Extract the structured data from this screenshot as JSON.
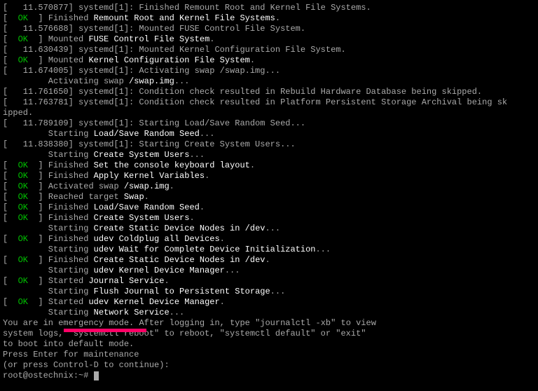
{
  "lines": [
    {
      "kind": "ts",
      "time": "11.570877",
      "src": "systemd[1]",
      "msg": "Finished Remount Root and Kernel File Systems."
    },
    {
      "kind": "ok",
      "pre": "Finished ",
      "bold": "Remount Root and Kernel File Systems",
      "post": "."
    },
    {
      "kind": "ts",
      "time": "11.576688",
      "src": "systemd[1]",
      "msg": "Mounted FUSE Control File System."
    },
    {
      "kind": "ok",
      "pre": "Mounted ",
      "bold": "FUSE Control File System",
      "post": "."
    },
    {
      "kind": "ts",
      "time": "11.630439",
      "src": "systemd[1]",
      "msg": "Mounted Kernel Configuration File System."
    },
    {
      "kind": "ok",
      "pre": "Mounted ",
      "bold": "Kernel Configuration File System",
      "post": "."
    },
    {
      "kind": "ts",
      "time": "11.674005",
      "src": "systemd[1]",
      "msg": "Activating swap /swap.img..."
    },
    {
      "kind": "act",
      "pre": "Activating swap ",
      "bold": "/swap.img",
      "post": "..."
    },
    {
      "kind": "ts",
      "time": "11.761650",
      "src": "systemd[1]",
      "msg": "Condition check resulted in Rebuild Hardware Database being skipped."
    },
    {
      "kind": "tswrap",
      "time": "11.763781",
      "src": "systemd[1]",
      "msg": "Condition check resulted in Platform Persistent Storage Archival being sk",
      "wrap": "ipped."
    },
    {
      "kind": "ts",
      "time": "11.789109",
      "src": "systemd[1]",
      "msg": "Starting Load/Save Random Seed..."
    },
    {
      "kind": "act",
      "pre": "Starting ",
      "bold": "Load/Save Random Seed",
      "post": "..."
    },
    {
      "kind": "ts",
      "time": "11.838380",
      "src": "systemd[1]",
      "msg": "Starting Create System Users..."
    },
    {
      "kind": "act",
      "pre": "Starting ",
      "bold": "Create System Users",
      "post": "..."
    },
    {
      "kind": "ok",
      "pre": "Finished ",
      "bold": "Set the console keyboard layout",
      "post": "."
    },
    {
      "kind": "ok",
      "pre": "Finished ",
      "bold": "Apply Kernel Variables",
      "post": "."
    },
    {
      "kind": "ok",
      "pre": "Activated swap ",
      "bold": "/swap.img",
      "post": "."
    },
    {
      "kind": "ok",
      "pre": "Reached target ",
      "bold": "Swap",
      "post": "."
    },
    {
      "kind": "ok",
      "pre": "Finished ",
      "bold": "Load/Save Random Seed",
      "post": "."
    },
    {
      "kind": "ok",
      "pre": "Finished ",
      "bold": "Create System Users",
      "post": "."
    },
    {
      "kind": "act",
      "pre": "Starting ",
      "bold": "Create Static Device Nodes in /dev",
      "post": "..."
    },
    {
      "kind": "ok",
      "pre": "Finished ",
      "bold": "udev Coldplug all Devices",
      "post": "."
    },
    {
      "kind": "act",
      "pre": "Starting ",
      "bold": "udev Wait for Complete Device Initialization",
      "post": "..."
    },
    {
      "kind": "ok",
      "pre": "Finished ",
      "bold": "Create Static Device Nodes in /dev",
      "post": "."
    },
    {
      "kind": "act",
      "pre": "Starting ",
      "bold": "udev Kernel Device Manager",
      "post": "..."
    },
    {
      "kind": "ok",
      "pre": "Started ",
      "bold": "Journal Service",
      "post": "."
    },
    {
      "kind": "act",
      "pre": "Starting ",
      "bold": "Flush Journal to Persistent Storage",
      "post": "..."
    },
    {
      "kind": "ok",
      "pre": "Started ",
      "bold": "udev Kernel Device Manager",
      "post": "."
    },
    {
      "kind": "act",
      "pre": "Starting ",
      "bold": "Network Service",
      "post": "..."
    }
  ],
  "emergency": {
    "l1a": "You are in ",
    "l1b": "emergency mode",
    "l1c": ". After logging in, type \"journalctl -xb\" to view",
    "l2a": "system logs, \"systemctl reboot\" to reboot, \"systemctl default\" or \"exit\"",
    "l3": "to boot into default mode.",
    "l4": "Press Enter for maintenance",
    "l5": "(or press Control-D to continue):",
    "prompt": "root@ostechnix:~#"
  }
}
